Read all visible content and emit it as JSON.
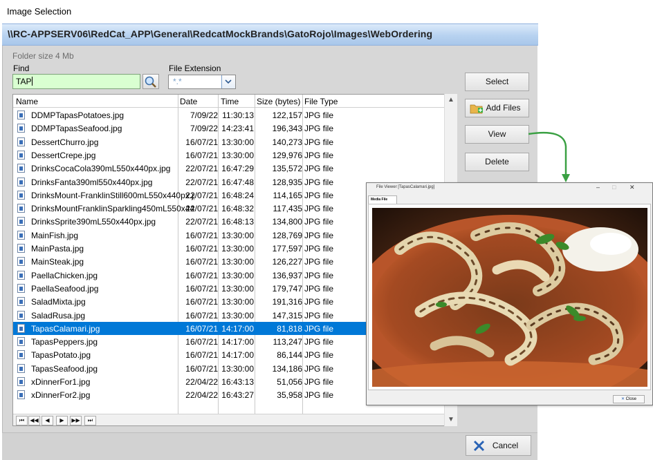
{
  "window": {
    "title": "Image Selection",
    "path": "\\\\RC-APPSERV06\\RedCat_APP\\General\\RedcatMockBrands\\GatoRojo\\Images\\WebOrdering",
    "folder_size": "Folder size 4 Mb"
  },
  "find": {
    "label": "Find",
    "value": "TAP"
  },
  "extension": {
    "label": "File Extension",
    "value": "*.*"
  },
  "buttons": {
    "select": "Select",
    "add_files": "Add Files",
    "view": "View",
    "delete": "Delete",
    "cancel": "Cancel"
  },
  "table": {
    "headers": {
      "name": "Name",
      "date": "Date",
      "time": "Time",
      "size": "Size (bytes)",
      "type": "File Type"
    },
    "rows": [
      {
        "name": "DDMPTapasPotatoes.jpg",
        "date": "7/09/22",
        "time": "11:30:13",
        "size": "122,157",
        "type": "JPG file"
      },
      {
        "name": "DDMPTapasSeafood.jpg",
        "date": "7/09/22",
        "time": "14:23:41",
        "size": "196,343",
        "type": "JPG file"
      },
      {
        "name": "DessertChurro.jpg",
        "date": "16/07/21",
        "time": "13:30:00",
        "size": "140,273",
        "type": "JPG file"
      },
      {
        "name": "DessertCrepe.jpg",
        "date": "16/07/21",
        "time": "13:30:00",
        "size": "129,976",
        "type": "JPG file"
      },
      {
        "name": "DrinksCocaCola390mL550x440px.jpg",
        "date": "22/07/21",
        "time": "16:47:29",
        "size": "135,572",
        "type": "JPG file"
      },
      {
        "name": "DrinksFanta390ml550x440px.jpg",
        "date": "22/07/21",
        "time": "16:47:48",
        "size": "128,935",
        "type": "JPG file"
      },
      {
        "name": "DrinksMount-FranklinStill600mL550x440px.jpg",
        "date": "22/07/21",
        "time": "16:48:24",
        "size": "114,165",
        "type": "JPG file"
      },
      {
        "name": "DrinksMountFranklinSparkling450mL550x440px.jpg",
        "date": "22/07/21",
        "time": "16:48:32",
        "size": "117,435",
        "type": "JPG file"
      },
      {
        "name": "DrinksSprite390mL550x440px.jpg",
        "date": "22/07/21",
        "time": "16:48:13",
        "size": "134,800",
        "type": "JPG file"
      },
      {
        "name": "MainFish.jpg",
        "date": "16/07/21",
        "time": "13:30:00",
        "size": "128,769",
        "type": "JPG file"
      },
      {
        "name": "MainPasta.jpg",
        "date": "16/07/21",
        "time": "13:30:00",
        "size": "177,597",
        "type": "JPG file"
      },
      {
        "name": "MainSteak.jpg",
        "date": "16/07/21",
        "time": "13:30:00",
        "size": "126,227",
        "type": "JPG file"
      },
      {
        "name": "PaellaChicken.jpg",
        "date": "16/07/21",
        "time": "13:30:00",
        "size": "136,937",
        "type": "JPG file"
      },
      {
        "name": "PaellaSeafood.jpg",
        "date": "16/07/21",
        "time": "13:30:00",
        "size": "179,747",
        "type": "JPG file"
      },
      {
        "name": "SaladMixta.jpg",
        "date": "16/07/21",
        "time": "13:30:00",
        "size": "191,316",
        "type": "JPG file"
      },
      {
        "name": "SaladRusa.jpg",
        "date": "16/07/21",
        "time": "13:30:00",
        "size": "147,315",
        "type": "JPG file"
      },
      {
        "name": "TapasCalamari.jpg",
        "date": "16/07/21",
        "time": "14:17:00",
        "size": "81,818",
        "type": "JPG file",
        "selected": true
      },
      {
        "name": "TapasPeppers.jpg",
        "date": "16/07/21",
        "time": "14:17:00",
        "size": "113,247",
        "type": "JPG file"
      },
      {
        "name": "TapasPotato.jpg",
        "date": "16/07/21",
        "time": "14:17:00",
        "size": "86,144",
        "type": "JPG file"
      },
      {
        "name": "TapasSeafood.jpg",
        "date": "16/07/21",
        "time": "13:30:00",
        "size": "134,186",
        "type": "JPG file"
      },
      {
        "name": "xDinnerFor1.jpg",
        "date": "22/04/22",
        "time": "16:43:13",
        "size": "51,056",
        "type": "JPG file"
      },
      {
        "name": "xDinnerFor2.jpg",
        "date": "22/04/22",
        "time": "16:43:27",
        "size": "35,958",
        "type": "JPG file"
      }
    ]
  },
  "pager": [
    "⏮",
    "◀◀",
    "◀",
    "▶",
    "▶▶",
    "⏭"
  ],
  "viewer": {
    "title": "File Viewer [TapasCalamari.jpg]",
    "tab": "Media File",
    "close_label": "Close",
    "controls": [
      "–",
      "□",
      "✕"
    ]
  },
  "colors": {
    "selection": "#0078d7",
    "arrow": "#3aa043",
    "find_bg": "#d9ffd1"
  }
}
